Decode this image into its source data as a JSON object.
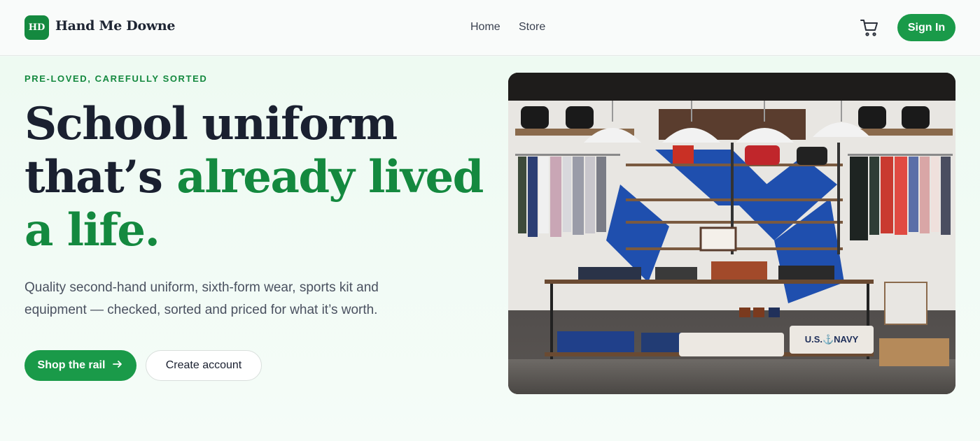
{
  "brand": {
    "initials": "HD",
    "name": "Hand Me Downe"
  },
  "nav": {
    "home": "Home",
    "store": "Store"
  },
  "header": {
    "sign_in": "Sign In"
  },
  "hero": {
    "eyebrow": "PRE-LOVED, CAREFULLY SORTED",
    "headline_plain": "School uniform that’s ",
    "headline_accent": "already lived a life.",
    "subtext": "Quality second-hand uniform, sixth-form wear, sports kit and equipment — checked, sorted and priced for what it’s worth.",
    "primary_cta": "Shop the rail",
    "secondary_cta": "Create account"
  },
  "photo": {
    "sign_text": "U.S.⚓NAVY",
    "icon": "clothing-store-photo"
  },
  "colors": {
    "accent": "#14893f",
    "button": "#1a9a49",
    "ink": "#1a2030"
  }
}
